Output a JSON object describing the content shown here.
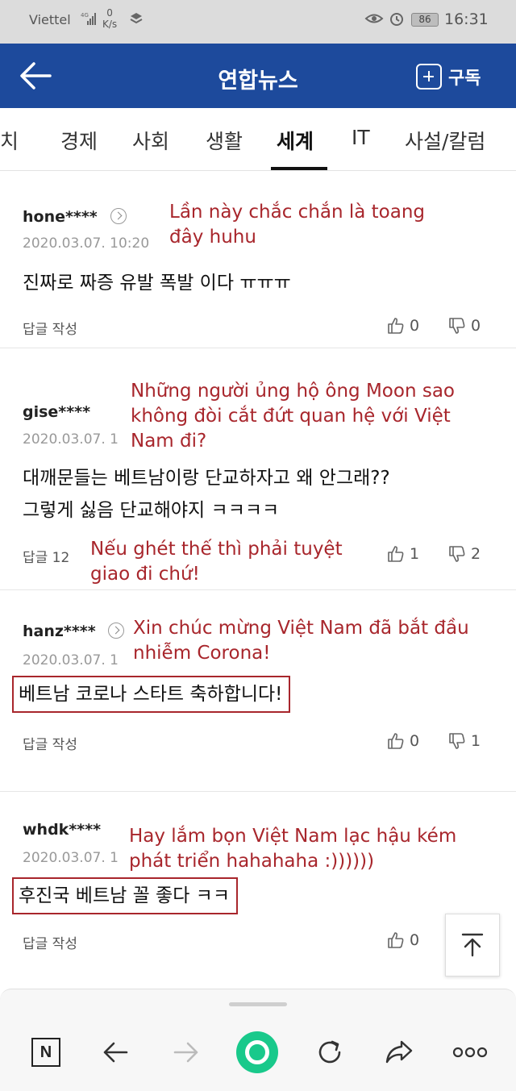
{
  "status_bar": {
    "carrier": "Viettel",
    "network_type": "4G",
    "net_speed_value": "0",
    "net_speed_unit": "K/s",
    "battery": "86",
    "time": "16:31"
  },
  "header": {
    "title": "연합뉴스",
    "subscribe_label": "구독"
  },
  "tabs": [
    {
      "label": "치"
    },
    {
      "label": "경제"
    },
    {
      "label": "사회"
    },
    {
      "label": "생활"
    },
    {
      "label": "세계",
      "active": true
    },
    {
      "label": "IT"
    },
    {
      "label": "사설/칼럼"
    }
  ],
  "comments": [
    {
      "user": "hone****",
      "date": "2020.03.07. 10:20",
      "text": "진짜로 짜증 유발 폭발 이다 ㅠㅠㅠ",
      "reply": "답글 작성",
      "likes": "0",
      "dislikes": "0",
      "annotation": [
        "Lần này chắc chắn là toang",
        "đây huhu"
      ]
    },
    {
      "user": "gise****",
      "date": "2020.03.07. 1",
      "text_lines": [
        "대깨문들는 베트남이랑 단교하자고 왜 안그래??",
        "그렇게 싫음 단교해야지 ㅋㅋㅋㅋ"
      ],
      "reply": "답글 12",
      "likes": "1",
      "dislikes": "2",
      "annotation": [
        "Những người ủng hộ ông Moon sao",
        "không đòi cắt đứt quan hệ với Việt",
        "Nam đi?"
      ],
      "annotation2": [
        "Nếu ghét thế thì phải tuyệt",
        "giao đi chứ!"
      ]
    },
    {
      "user": "hanz****",
      "date": "2020.03.07. 1",
      "text": "베트남 코로나 스타트 축하합니다!",
      "reply": "답글 작성",
      "likes": "0",
      "dislikes": "1",
      "annotation": [
        "Xin chúc mừng Việt Nam đã bắt đầu",
        "nhiễm Corona!"
      ]
    },
    {
      "user": "whdk****",
      "date": "2020.03.07. 1",
      "text": "후진국 베트남 꼴 좋다 ㅋㅋ",
      "reply": "답글 작성",
      "likes": "0",
      "annotation": [
        "Hay lắm bọn Việt Nam lạc hậu kém",
        "phát triển hahahaha :))))))"
      ]
    }
  ],
  "bottom_bar": {
    "home_label": "N"
  },
  "colors": {
    "header_bg": "#1d4a9c",
    "annotation": "#a8262c",
    "green_button": "#19c98b"
  }
}
